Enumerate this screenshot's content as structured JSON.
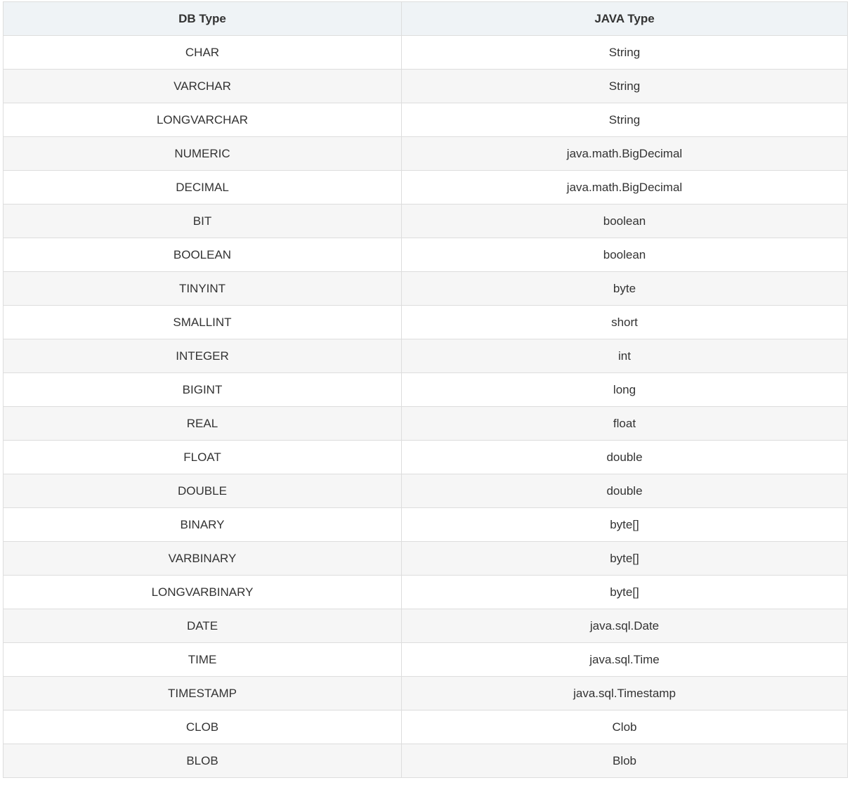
{
  "table": {
    "headers": [
      "DB Type",
      "JAVA Type"
    ],
    "rows": [
      [
        "CHAR",
        "String"
      ],
      [
        "VARCHAR",
        "String"
      ],
      [
        "LONGVARCHAR",
        "String"
      ],
      [
        "NUMERIC",
        "java.math.BigDecimal"
      ],
      [
        "DECIMAL",
        "java.math.BigDecimal"
      ],
      [
        "BIT",
        "boolean"
      ],
      [
        "BOOLEAN",
        "boolean"
      ],
      [
        "TINYINT",
        "byte"
      ],
      [
        "SMALLINT",
        "short"
      ],
      [
        "INTEGER",
        "int"
      ],
      [
        "BIGINT",
        "long"
      ],
      [
        "REAL",
        "float"
      ],
      [
        "FLOAT",
        "double"
      ],
      [
        "DOUBLE",
        "double"
      ],
      [
        "BINARY",
        "byte[]"
      ],
      [
        "VARBINARY",
        "byte[]"
      ],
      [
        "LONGVARBINARY",
        "byte[]"
      ],
      [
        "DATE",
        "java.sql.Date"
      ],
      [
        "TIME",
        "java.sql.Time"
      ],
      [
        "TIMESTAMP",
        "java.sql.Timestamp"
      ],
      [
        "CLOB",
        "Clob"
      ],
      [
        "BLOB",
        "Blob"
      ]
    ]
  }
}
